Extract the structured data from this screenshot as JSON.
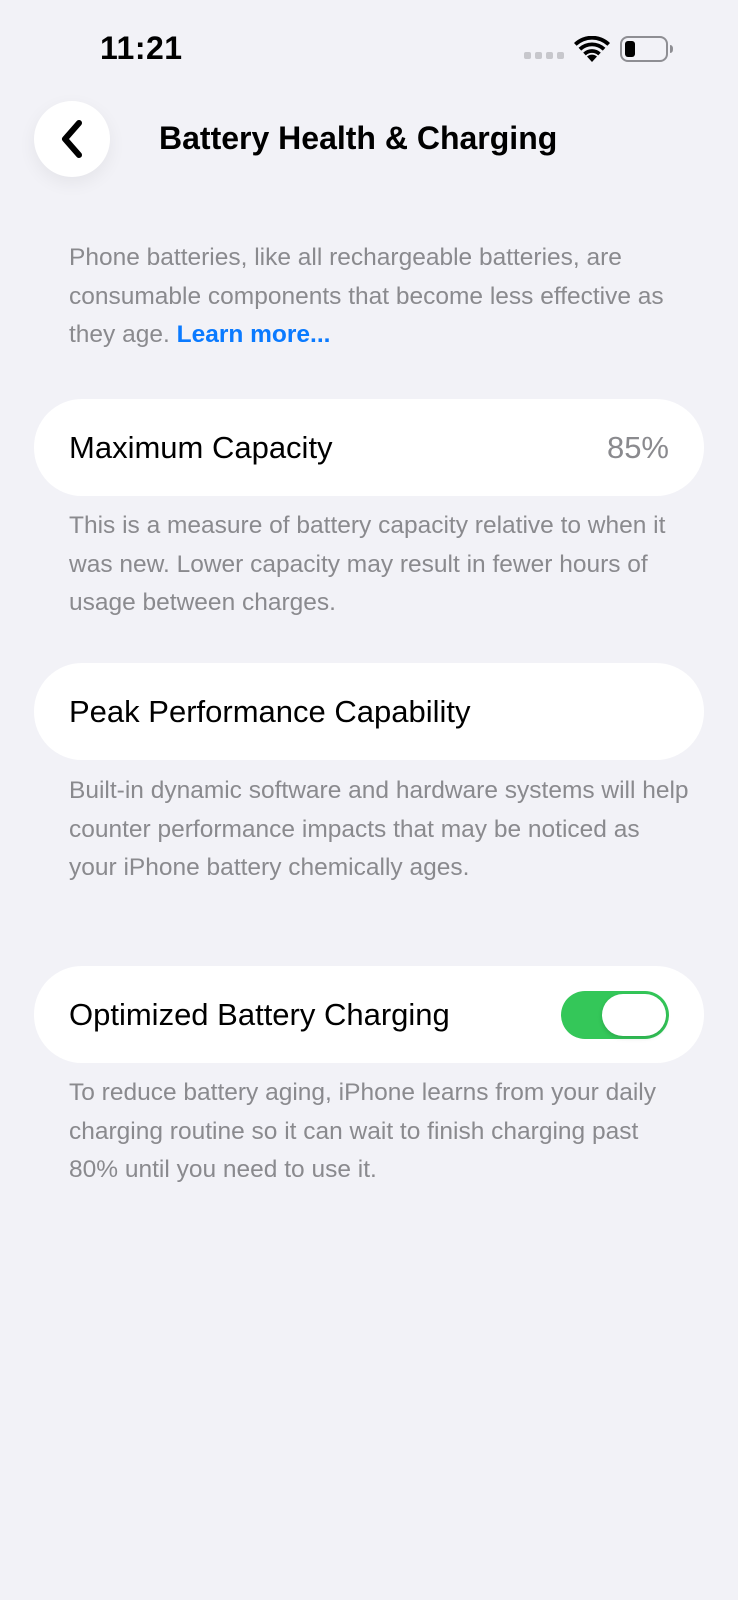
{
  "status_bar": {
    "time": "11:21"
  },
  "header": {
    "title": "Battery Health & Charging"
  },
  "intro": {
    "text": "Phone batteries, like all rechargeable batteries, are consumable components that become less effective as they age.",
    "link_label": "Learn more..."
  },
  "max_capacity": {
    "label": "Maximum Capacity",
    "value": "85%",
    "description": "This is a measure of battery capacity relative to when it was new. Lower capacity may result in fewer hours of usage between charges."
  },
  "peak_performance": {
    "label": "Peak Performance Capability",
    "description": "Built-in dynamic software and hardware systems will help counter performance impacts that may be noticed as your iPhone battery chemically ages."
  },
  "optimized_charging": {
    "label": "Optimized Battery Charging",
    "enabled": true,
    "description": "To reduce battery aging, iPhone learns from your daily charging routine so it can wait to finish charging past 80% until you need to use it."
  },
  "colors": {
    "accent": "#0a7aff",
    "toggle_on": "#34c759",
    "background": "#f2f2f7",
    "secondary_text": "#8a8a8e"
  },
  "icons": {
    "back": "chevron-left-icon",
    "wifi": "wifi-icon",
    "battery": "battery-icon",
    "signal": "cellular-signal-icon"
  }
}
